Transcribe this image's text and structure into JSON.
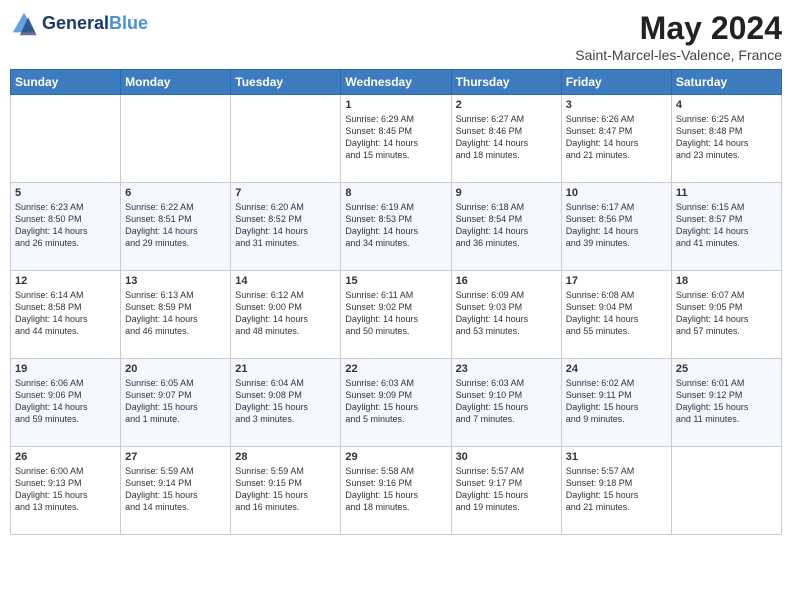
{
  "header": {
    "logo_line1": "General",
    "logo_line2": "Blue",
    "month": "May 2024",
    "location": "Saint-Marcel-les-Valence, France"
  },
  "weekdays": [
    "Sunday",
    "Monday",
    "Tuesday",
    "Wednesday",
    "Thursday",
    "Friday",
    "Saturday"
  ],
  "weeks": [
    [
      {
        "day": "",
        "info": ""
      },
      {
        "day": "",
        "info": ""
      },
      {
        "day": "",
        "info": ""
      },
      {
        "day": "1",
        "info": "Sunrise: 6:29 AM\nSunset: 8:45 PM\nDaylight: 14 hours\nand 15 minutes."
      },
      {
        "day": "2",
        "info": "Sunrise: 6:27 AM\nSunset: 8:46 PM\nDaylight: 14 hours\nand 18 minutes."
      },
      {
        "day": "3",
        "info": "Sunrise: 6:26 AM\nSunset: 8:47 PM\nDaylight: 14 hours\nand 21 minutes."
      },
      {
        "day": "4",
        "info": "Sunrise: 6:25 AM\nSunset: 8:48 PM\nDaylight: 14 hours\nand 23 minutes."
      }
    ],
    [
      {
        "day": "5",
        "info": "Sunrise: 6:23 AM\nSunset: 8:50 PM\nDaylight: 14 hours\nand 26 minutes."
      },
      {
        "day": "6",
        "info": "Sunrise: 6:22 AM\nSunset: 8:51 PM\nDaylight: 14 hours\nand 29 minutes."
      },
      {
        "day": "7",
        "info": "Sunrise: 6:20 AM\nSunset: 8:52 PM\nDaylight: 14 hours\nand 31 minutes."
      },
      {
        "day": "8",
        "info": "Sunrise: 6:19 AM\nSunset: 8:53 PM\nDaylight: 14 hours\nand 34 minutes."
      },
      {
        "day": "9",
        "info": "Sunrise: 6:18 AM\nSunset: 8:54 PM\nDaylight: 14 hours\nand 36 minutes."
      },
      {
        "day": "10",
        "info": "Sunrise: 6:17 AM\nSunset: 8:56 PM\nDaylight: 14 hours\nand 39 minutes."
      },
      {
        "day": "11",
        "info": "Sunrise: 6:15 AM\nSunset: 8:57 PM\nDaylight: 14 hours\nand 41 minutes."
      }
    ],
    [
      {
        "day": "12",
        "info": "Sunrise: 6:14 AM\nSunset: 8:58 PM\nDaylight: 14 hours\nand 44 minutes."
      },
      {
        "day": "13",
        "info": "Sunrise: 6:13 AM\nSunset: 8:59 PM\nDaylight: 14 hours\nand 46 minutes."
      },
      {
        "day": "14",
        "info": "Sunrise: 6:12 AM\nSunset: 9:00 PM\nDaylight: 14 hours\nand 48 minutes."
      },
      {
        "day": "15",
        "info": "Sunrise: 6:11 AM\nSunset: 9:02 PM\nDaylight: 14 hours\nand 50 minutes."
      },
      {
        "day": "16",
        "info": "Sunrise: 6:09 AM\nSunset: 9:03 PM\nDaylight: 14 hours\nand 53 minutes."
      },
      {
        "day": "17",
        "info": "Sunrise: 6:08 AM\nSunset: 9:04 PM\nDaylight: 14 hours\nand 55 minutes."
      },
      {
        "day": "18",
        "info": "Sunrise: 6:07 AM\nSunset: 9:05 PM\nDaylight: 14 hours\nand 57 minutes."
      }
    ],
    [
      {
        "day": "19",
        "info": "Sunrise: 6:06 AM\nSunset: 9:06 PM\nDaylight: 14 hours\nand 59 minutes."
      },
      {
        "day": "20",
        "info": "Sunrise: 6:05 AM\nSunset: 9:07 PM\nDaylight: 15 hours\nand 1 minute."
      },
      {
        "day": "21",
        "info": "Sunrise: 6:04 AM\nSunset: 9:08 PM\nDaylight: 15 hours\nand 3 minutes."
      },
      {
        "day": "22",
        "info": "Sunrise: 6:03 AM\nSunset: 9:09 PM\nDaylight: 15 hours\nand 5 minutes."
      },
      {
        "day": "23",
        "info": "Sunrise: 6:03 AM\nSunset: 9:10 PM\nDaylight: 15 hours\nand 7 minutes."
      },
      {
        "day": "24",
        "info": "Sunrise: 6:02 AM\nSunset: 9:11 PM\nDaylight: 15 hours\nand 9 minutes."
      },
      {
        "day": "25",
        "info": "Sunrise: 6:01 AM\nSunset: 9:12 PM\nDaylight: 15 hours\nand 11 minutes."
      }
    ],
    [
      {
        "day": "26",
        "info": "Sunrise: 6:00 AM\nSunset: 9:13 PM\nDaylight: 15 hours\nand 13 minutes."
      },
      {
        "day": "27",
        "info": "Sunrise: 5:59 AM\nSunset: 9:14 PM\nDaylight: 15 hours\nand 14 minutes."
      },
      {
        "day": "28",
        "info": "Sunrise: 5:59 AM\nSunset: 9:15 PM\nDaylight: 15 hours\nand 16 minutes."
      },
      {
        "day": "29",
        "info": "Sunrise: 5:58 AM\nSunset: 9:16 PM\nDaylight: 15 hours\nand 18 minutes."
      },
      {
        "day": "30",
        "info": "Sunrise: 5:57 AM\nSunset: 9:17 PM\nDaylight: 15 hours\nand 19 minutes."
      },
      {
        "day": "31",
        "info": "Sunrise: 5:57 AM\nSunset: 9:18 PM\nDaylight: 15 hours\nand 21 minutes."
      },
      {
        "day": "",
        "info": ""
      }
    ]
  ]
}
